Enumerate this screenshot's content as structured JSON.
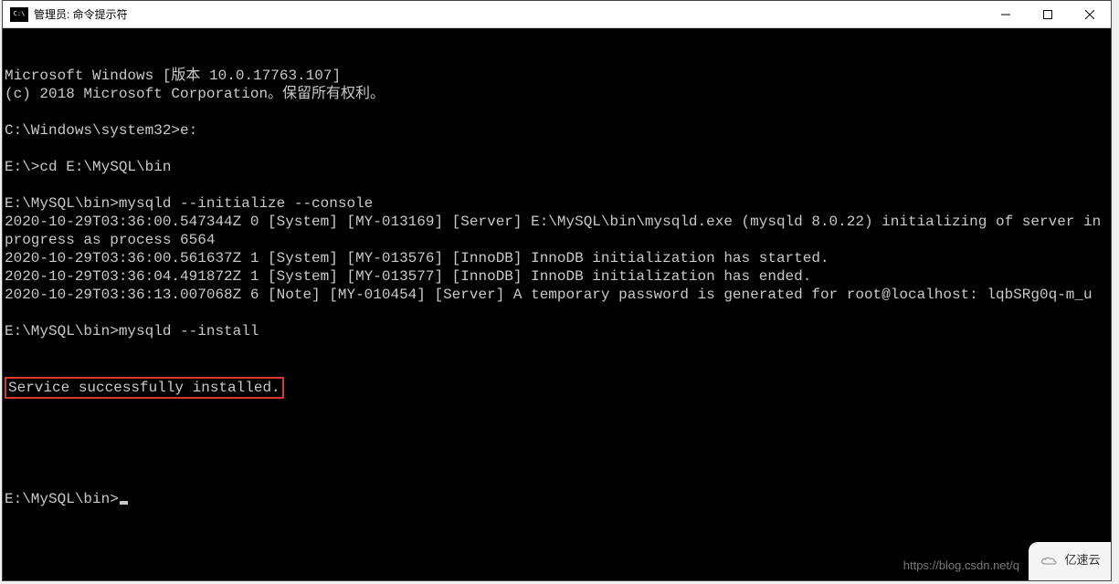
{
  "window": {
    "title": "管理员: 命令提示符"
  },
  "terminal": {
    "lines": [
      "Microsoft Windows [版本 10.0.17763.107]",
      "(c) 2018 Microsoft Corporation。保留所有权利。",
      "",
      "C:\\Windows\\system32>e:",
      "",
      "E:\\>cd E:\\MySQL\\bin",
      "",
      "E:\\MySQL\\bin>mysqld --initialize --console",
      "2020-10-29T03:36:00.547344Z 0 [System] [MY-013169] [Server] E:\\MySQL\\bin\\mysqld.exe (mysqld 8.0.22) initializing of server in progress as process 6564",
      "2020-10-29T03:36:00.561637Z 1 [System] [MY-013576] [InnoDB] InnoDB initialization has started.",
      "2020-10-29T03:36:04.491872Z 1 [System] [MY-013577] [InnoDB] InnoDB initialization has ended.",
      "2020-10-29T03:36:13.007068Z 6 [Note] [MY-010454] [Server] A temporary password is generated for root@localhost: lqbSRg0q-m_u",
      "",
      "E:\\MySQL\\bin>mysqld --install"
    ],
    "highlighted_line": "Service successfully installed.",
    "after_lines": [
      ""
    ],
    "current_prompt": "E:\\MySQL\\bin>"
  },
  "watermark": {
    "url_text": "https://blog.csdn.net/q",
    "brand": "亿速云"
  }
}
